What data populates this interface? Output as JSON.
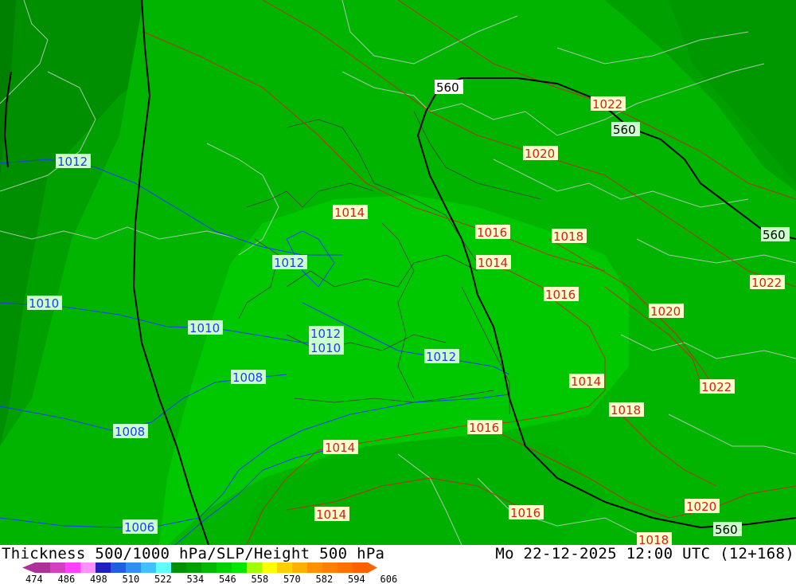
{
  "title": "Thickness 500/1000 hPa/SLP/Height 500 hPa",
  "valid_time": "Mo 22-12-2025 12:00 UTC (12+168)",
  "legend": {
    "ticks": [
      "474",
      "486",
      "498",
      "510",
      "522",
      "534",
      "546",
      "558",
      "570",
      "582",
      "594",
      "606"
    ],
    "colors": [
      "#b0309a",
      "#d040c0",
      "#ff40ff",
      "#ff90ff",
      "#2020c0",
      "#2060e0",
      "#3090f0",
      "#40c0ff",
      "#60ffff",
      "#009000",
      "#00a000",
      "#00b800",
      "#00d000",
      "#00e800",
      "#a0ff00",
      "#ffff00",
      "#ffd000",
      "#ffb000",
      "#ff9000",
      "#ff8000",
      "#ff7000",
      "#ff6000"
    ]
  },
  "map": {
    "slp_labels_blue": [
      "1012",
      "1010",
      "1012",
      "1010",
      "1012",
      "1010",
      "1008",
      "1012",
      "1008",
      "1006"
    ],
    "slp_labels_red": [
      "1022",
      "1020",
      "1014",
      "1016",
      "1018",
      "1014",
      "1022",
      "1016",
      "1020",
      "1014",
      "1022",
      "1018",
      "1016",
      "1014",
      "1014",
      "1016",
      "1020",
      "1018"
    ],
    "height_labels": [
      "560",
      "560",
      "560",
      "560"
    ]
  }
}
